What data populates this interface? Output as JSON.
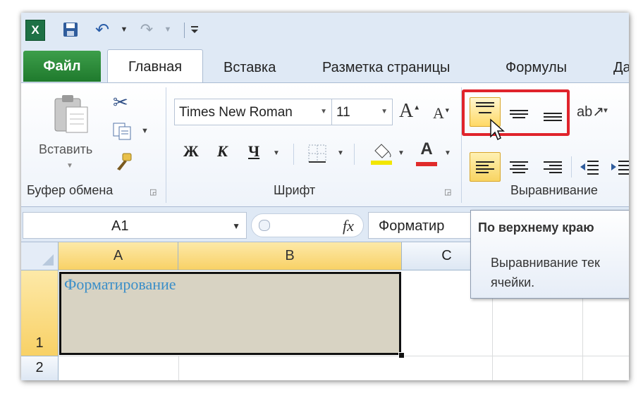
{
  "quick_access": {
    "app_icon": "excel-logo-icon",
    "app_letter": "X",
    "save_icon": "save-icon",
    "undo_icon": "undo-icon",
    "redo_icon": "redo-icon",
    "customize_icon": "customize-toolbar-icon"
  },
  "tabs": [
    {
      "label": "Файл",
      "active": false,
      "color": "#2a8c3c"
    },
    {
      "label": "Главная",
      "active": true
    },
    {
      "label": "Вставка",
      "active": false
    },
    {
      "label": "Разметка страницы",
      "active": false
    },
    {
      "label": "Формулы",
      "active": false
    },
    {
      "label": "Да",
      "active": false
    }
  ],
  "ribbon": {
    "clipboard": {
      "paste_label": "Вставить",
      "group_label": "Буфер обмена",
      "icons": [
        "paste-icon",
        "cut-icon",
        "copy-icon",
        "format-painter-icon"
      ]
    },
    "font": {
      "font_name": "Times New Roman",
      "font_size": "11",
      "grow_label": "A",
      "shrink_label": "A",
      "bold_label": "Ж",
      "italic_label": "К",
      "underline_label": "Ч",
      "font_color_label": "A",
      "font_color": "#e02b2b",
      "group_label": "Шрифт"
    },
    "alignment": {
      "group_label": "Выравнивание",
      "vertical": [
        "top-align-icon",
        "middle-align-icon",
        "bottom-align-icon"
      ],
      "active_vertical": "top-align-icon",
      "horizontal": [
        "align-left-icon",
        "align-center-icon",
        "align-right-icon"
      ],
      "active_horizontal": "align-left-icon",
      "highlight_color": "#e0242c"
    }
  },
  "formula_bar": {
    "name_box": "A1",
    "fx_label": "fx",
    "formula": "Форматир"
  },
  "tooltip": {
    "title": "По верхнему краю",
    "body_line1": "Выравнивание тек",
    "body_line2": "ячейки."
  },
  "sheet": {
    "columns": [
      "A",
      "B",
      "C"
    ],
    "rows": [
      "1",
      "2"
    ],
    "selected_columns": [
      "A",
      "B"
    ],
    "selected_row": "1",
    "cell_a1": "Форматирование",
    "cell_text_color": "#3a8ec8",
    "cell_fill": "#d8d3c3"
  }
}
